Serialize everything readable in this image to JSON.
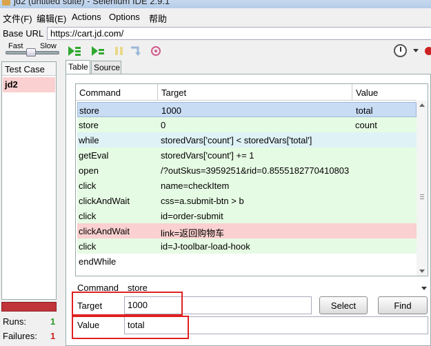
{
  "window": {
    "title": "jd2 (untitled suite) - Selenium IDE 2.9.1"
  },
  "menu": [
    {
      "label": "文件(F)"
    },
    {
      "label": "编辑(E)"
    },
    {
      "label": "Actions"
    },
    {
      "label": "Options"
    },
    {
      "label": "帮助"
    }
  ],
  "base_url": {
    "label": "Base URL",
    "value": "https://cart.jd.com/"
  },
  "speed": {
    "fast": "Fast",
    "slow": "Slow"
  },
  "left": {
    "header": "Test Case",
    "items": [
      {
        "label": "jd2"
      }
    ],
    "runs_label": "Runs:",
    "runs_value": "1",
    "failures_label": "Failures:",
    "failures_value": "1"
  },
  "tabs": [
    {
      "label": "Table"
    },
    {
      "label": "Source"
    }
  ],
  "table": {
    "columns": [
      "Command",
      "Target",
      "Value"
    ],
    "rows": [
      {
        "command": "store",
        "target": "1000",
        "value": "total",
        "state": "selected"
      },
      {
        "command": "store",
        "target": "0",
        "value": "count",
        "state": "passed"
      },
      {
        "command": "while",
        "target": "storedVars['count'] < storedVars['total']",
        "value": "",
        "state": "hover"
      },
      {
        "command": "getEval",
        "target": "storedVars['count'] += 1",
        "value": "",
        "state": "passed"
      },
      {
        "command": "open",
        "target": "/?outSkus=3959251&rid=0.8555182770410803",
        "value": "",
        "state": "passed"
      },
      {
        "command": "click",
        "target": "name=checkItem",
        "value": "",
        "state": "passed"
      },
      {
        "command": "clickAndWait",
        "target": "css=a.submit-btn > b",
        "value": "",
        "state": "passed"
      },
      {
        "command": "click",
        "target": "id=order-submit",
        "value": "",
        "state": "passed"
      },
      {
        "command": "clickAndWait",
        "target": "link=返回购物车",
        "value": "",
        "state": "failed"
      },
      {
        "command": "click",
        "target": "id=J-toolbar-load-hook",
        "value": "",
        "state": "passed"
      },
      {
        "command": "endWhile",
        "target": "",
        "value": "",
        "state": "none"
      }
    ]
  },
  "editor": {
    "command_label": "Command",
    "command_value": "store",
    "target_label": "Target",
    "target_value": "1000",
    "value_label": "Value",
    "value_value": "total",
    "select_button": "Select",
    "find_button": "Find"
  },
  "colors": {
    "passed": "#e6fbe4",
    "failed": "#fbd0d0",
    "selected": "#c8dcf4",
    "highlight_box": "#e02020",
    "progress": "#c0343a"
  }
}
